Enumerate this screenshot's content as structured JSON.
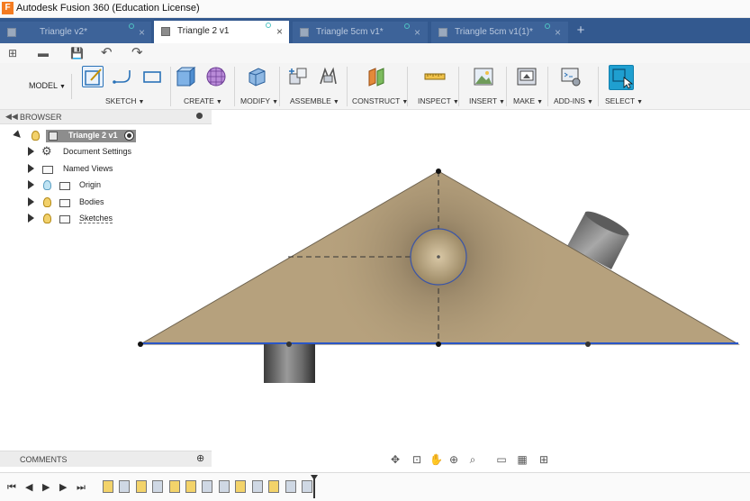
{
  "app": {
    "title": "Autodesk Fusion 360 (Education License)",
    "logo": "F"
  },
  "tabs": [
    {
      "label": "Triangle v2*",
      "active": false
    },
    {
      "label": "Triangle 2 v1",
      "active": true
    },
    {
      "label": "Triangle 5cm v1*",
      "active": false
    },
    {
      "label": "Triangle 5cm v1(1)*",
      "active": false
    }
  ],
  "close_glyph": "×",
  "new_tab_glyph": "+",
  "qat": {
    "grid": "⊞",
    "file": "▬",
    "save": "💾",
    "undo": "↶",
    "redo": "↷"
  },
  "ribbon": {
    "workspace": "MODEL",
    "groups": {
      "sketch": "SKETCH",
      "create": "CREATE",
      "modify": "MODIFY",
      "assemble": "ASSEMBLE",
      "construct": "CONSTRUCT",
      "inspect": "INSPECT",
      "insert": "INSERT",
      "make": "MAKE",
      "addins": "ADD-INS",
      "select": "SELECT"
    }
  },
  "browser": {
    "title": "BROWSER",
    "root": "Triangle 2 v1",
    "items": {
      "document_settings": "Document Settings",
      "named_views": "Named Views",
      "origin": "Origin",
      "bodies": "Bodies",
      "sketches": "Sketches"
    }
  },
  "comments": {
    "title": "COMMENTS"
  },
  "nav": {
    "orbit": "✥",
    "look": "⊡",
    "pan": "✋",
    "zoom": "⊕",
    "fit": "⌕",
    "display": "▭",
    "grid": "▦",
    "viewports": "⊞"
  },
  "timeline": {
    "first": "⏮",
    "prev": "◀",
    "play": "▶",
    "next": "▶",
    "last": "⏭"
  },
  "colors": {
    "tab_bar": "#33598f",
    "face": "#b6a17d",
    "selection": "#1f9fd0",
    "edge_blue": "#2a56c6"
  }
}
